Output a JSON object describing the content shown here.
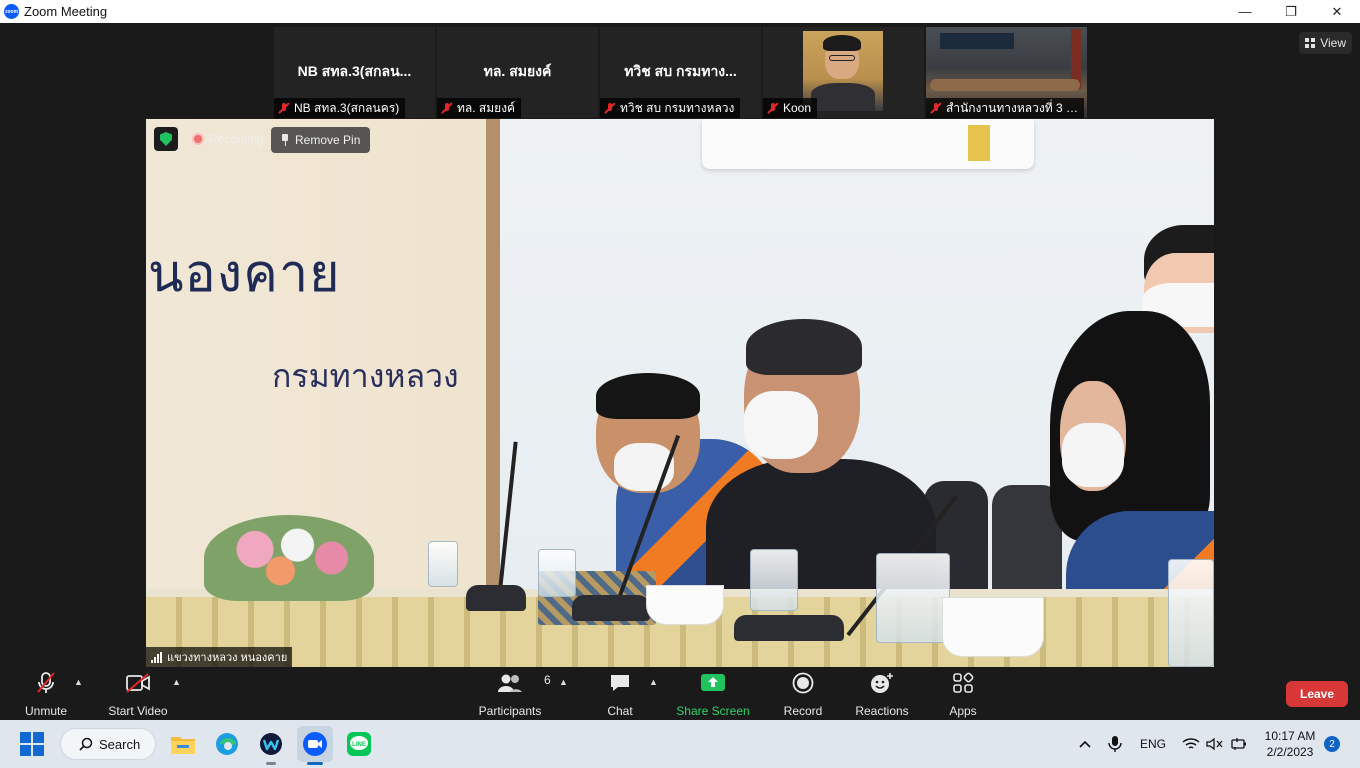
{
  "window": {
    "title": "Zoom Meeting",
    "logo_text": "zoom",
    "minimize": "—",
    "restore": "❐",
    "close": "✕"
  },
  "view_button": {
    "label": "View"
  },
  "participants_strip": [
    {
      "display": "NB สทล.3(สกลน...",
      "name": "NB สทล.3(สกลนคร)",
      "muted": true,
      "video": false
    },
    {
      "display": "ทล. สมยงค์",
      "name": "ทล. สมยงค์",
      "muted": true,
      "video": false
    },
    {
      "display": "ทวิช สบ กรมทาง...",
      "name": "ทวิช สบ กรมทางหลวง",
      "muted": true,
      "video": false
    },
    {
      "display": "",
      "name": "Koon",
      "muted": true,
      "video": true
    },
    {
      "display": "",
      "name": "สำนักงานทางหลวงที่ 3 ส...",
      "muted": true,
      "video": true
    }
  ],
  "main_video": {
    "recording_label": "Recording",
    "remove_pin_label": "Remove Pin",
    "speaker_name": "แขวงทางหลวง หนองคาย",
    "wall_text_1": "นองคาย",
    "wall_text_2": "กรมทางหลวง"
  },
  "toolbar": {
    "unmute": "Unmute",
    "start_video": "Start Video",
    "participants": "Participants",
    "participants_count": "6",
    "chat": "Chat",
    "share_screen": "Share Screen",
    "record": "Record",
    "reactions": "Reactions",
    "apps": "Apps",
    "leave": "Leave"
  },
  "taskbar": {
    "search_label": "Search",
    "language": "ENG",
    "time": "10:17 AM",
    "date": "2/2/2023",
    "notification_count": "2"
  },
  "colors": {
    "zoom_blue": "#0b5cff",
    "share_green": "#22c35e",
    "leave_red": "#d83737",
    "muted_red": "#e02828",
    "bg_dark": "#1a1a1a"
  }
}
